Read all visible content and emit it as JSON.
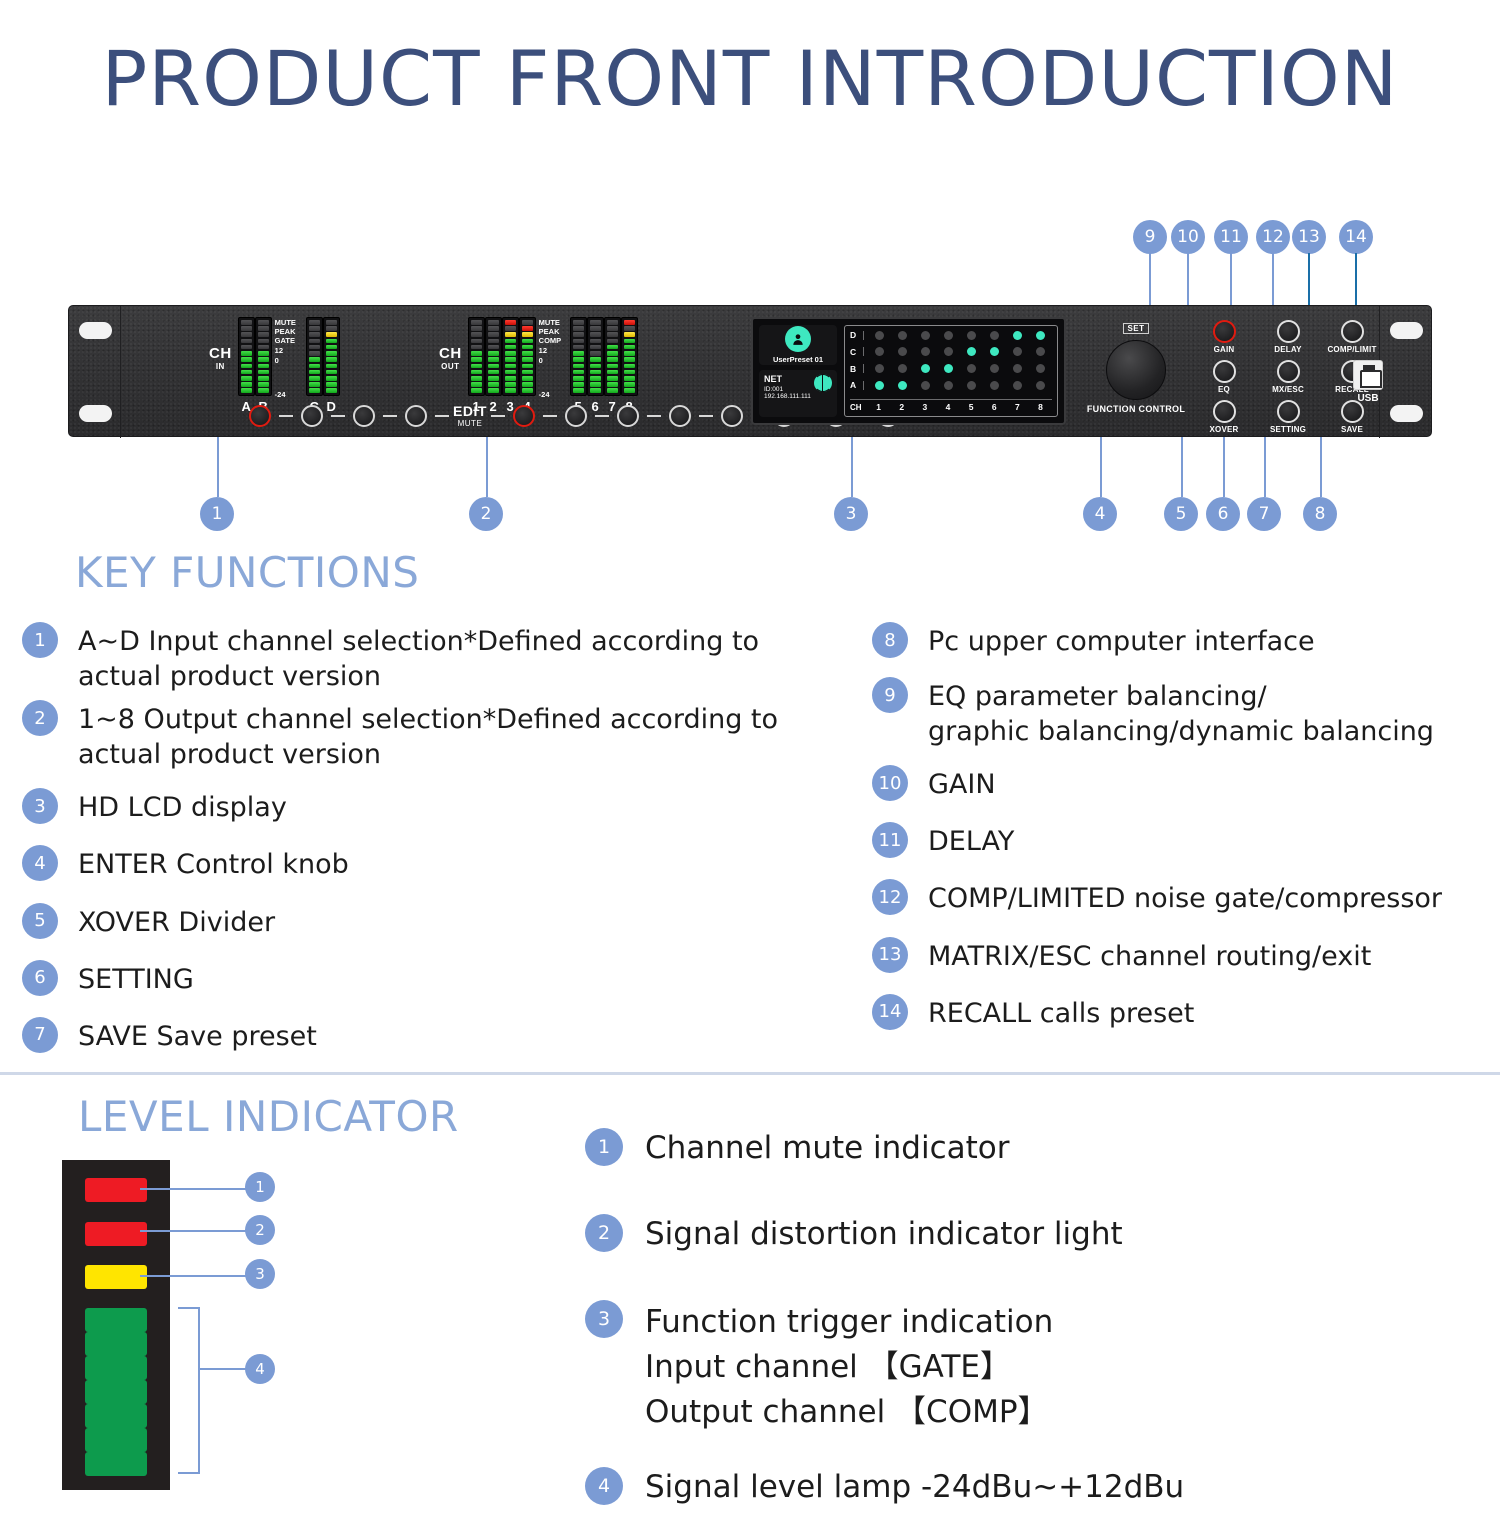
{
  "page": {
    "title": "PRODUCT FRONT INTRODUCTION"
  },
  "device": {
    "input_section": {
      "ch_label": "CH",
      "ch_sub": "IN",
      "channels": [
        "A",
        "B",
        "C",
        "D"
      ],
      "scale_labels": [
        "MUTE",
        "PEAK",
        "GATE",
        "12",
        "0",
        "-24"
      ]
    },
    "output_section": {
      "ch_label": "CH",
      "ch_sub": "OUT",
      "channels": [
        "1",
        "2",
        "3",
        "4",
        "5",
        "6",
        "7",
        "8"
      ],
      "scale_labels": [
        "MUTE",
        "PEAK",
        "COMP",
        "12",
        "0",
        "-24"
      ]
    },
    "edit_label": "EDIT",
    "edit_sub": "MUTE",
    "lcd": {
      "preset_name": "UserPreset 01",
      "net_title": "NET",
      "net_id": "ID:001",
      "net_ip": "192.168.111.111",
      "matrix": {
        "row_labels": [
          "D",
          "C",
          "B",
          "A"
        ],
        "ch_label": "CH",
        "col_labels": [
          "1",
          "2",
          "3",
          "4",
          "5",
          "6",
          "7",
          "8"
        ],
        "cells": [
          [
            0,
            0,
            0,
            0,
            0,
            0,
            1,
            1
          ],
          [
            0,
            0,
            0,
            0,
            1,
            1,
            0,
            0
          ],
          [
            0,
            0,
            1,
            1,
            0,
            0,
            0,
            0
          ],
          [
            1,
            1,
            0,
            0,
            0,
            0,
            0,
            0
          ]
        ]
      }
    },
    "knob": {
      "set_label": "SET",
      "caption": "FUNCTION CONTROL"
    },
    "function_buttons": [
      {
        "label": "GAIN",
        "accent": "red"
      },
      {
        "label": "DELAY",
        "accent": "white"
      },
      {
        "label": "COMP/LIMIT",
        "accent": "white"
      },
      {
        "label": "EQ",
        "accent": "white"
      },
      {
        "label": "MX/ESC",
        "accent": "white"
      },
      {
        "label": "RECALL",
        "accent": "white"
      },
      {
        "label": "XOVER",
        "accent": "white"
      },
      {
        "label": "SETTING",
        "accent": "white"
      },
      {
        "label": "SAVE",
        "accent": "white"
      }
    ],
    "usb_label": "USB",
    "callout_badges": [
      "1",
      "2",
      "3",
      "4",
      "5",
      "6",
      "7",
      "8",
      "9",
      "10",
      "11",
      "12",
      "13",
      "14"
    ]
  },
  "key_functions": {
    "heading": "KEY FUNCTIONS",
    "left_items": [
      {
        "num": "1",
        "text": "A~D Input channel selection*Defined according to actual product version"
      },
      {
        "num": "2",
        "text": "1~8 Output channel selection*Defined according to actual product version"
      },
      {
        "num": "3",
        "text": "HD LCD display"
      },
      {
        "num": "4",
        "text": "ENTER Control knob"
      },
      {
        "num": "5",
        "text": "XOVER Divider"
      },
      {
        "num": "6",
        "text": "SETTING"
      },
      {
        "num": "7",
        "text": "SAVE Save preset"
      }
    ],
    "right_items": [
      {
        "num": "8",
        "text": "Pc upper computer interface"
      },
      {
        "num": "9",
        "text": "EQ parameter balancing/\ngraphic balancing/dynamic balancing"
      },
      {
        "num": "10",
        "text": "GAIN"
      },
      {
        "num": "11",
        "text": "DELAY"
      },
      {
        "num": "12",
        "text": "COMP/LIMITED noise gate/compressor"
      },
      {
        "num": "13",
        "text": "MATRIX/ESC channel routing/exit"
      },
      {
        "num": "14",
        "text": "RECALL calls preset"
      }
    ]
  },
  "level_indicator": {
    "heading": "LEVEL INDICATOR",
    "segments": [
      "red",
      "red",
      "yellow",
      "green",
      "green",
      "green",
      "green",
      "green",
      "green",
      "green"
    ],
    "callouts": [
      "1",
      "2",
      "3",
      "4"
    ],
    "items": [
      {
        "num": "1",
        "text": "Channel mute indicator"
      },
      {
        "num": "2",
        "text": "Signal distortion indicator light"
      },
      {
        "num": "3",
        "text": "Function trigger indication\nInput channel 【GATE】\nOutput channel 【COMP】"
      },
      {
        "num": "4",
        "text": "Signal level lamp  -24dBu~+12dBu"
      }
    ]
  },
  "colors": {
    "badge_blue": "#7b9bd4",
    "title_blue": "#3c4f7c",
    "section_blue": "#8aa8d8",
    "leader_dark": "#1a6fa8",
    "led_green": "#0d9b4d",
    "led_red": "#ee1b24",
    "led_yellow": "#ffe500",
    "lcd_cyan": "#3ee8c0"
  }
}
